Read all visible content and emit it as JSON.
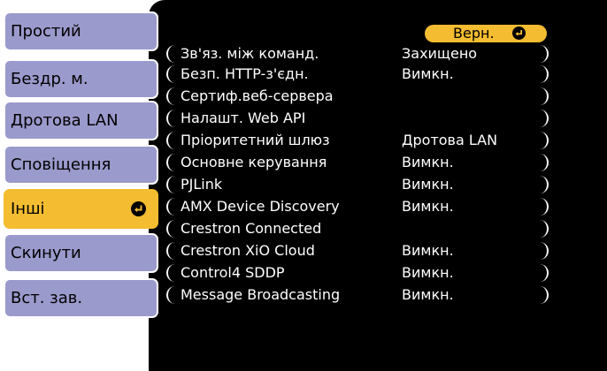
{
  "sidebar": {
    "items": [
      {
        "label": "Простий",
        "active": false
      },
      {
        "label": "Бездр. м.",
        "active": false
      },
      {
        "label": "Дротова LAN",
        "active": false
      },
      {
        "label": "Сповіщення",
        "active": false
      },
      {
        "label": "Інші",
        "active": true
      },
      {
        "label": "Скинути",
        "active": false
      },
      {
        "label": "Вст. зав.",
        "active": false
      }
    ]
  },
  "header": {
    "return_label": "Верн.",
    "return_icon": "enter-icon"
  },
  "settings": {
    "rows": [
      {
        "label": "Зв'яз. між команд.",
        "value": "Захищено"
      },
      {
        "label": "Безп. HTTP-з'єдн.",
        "value": "Вимкн."
      },
      {
        "label": "Сертиф.веб-сервера",
        "value": ""
      },
      {
        "label": "Налашт. Web API",
        "value": ""
      },
      {
        "label": "Пріоритетний шлюз",
        "value": "Дротова LAN"
      },
      {
        "label": "Основне керування",
        "value": "Вимкн."
      },
      {
        "label": "PJLink",
        "value": "Вимкн."
      },
      {
        "label": "AMX Device Discovery",
        "value": "Вимкн."
      },
      {
        "label": "Crestron Connected",
        "value": ""
      },
      {
        "label": "Crestron XiO Cloud",
        "value": "Вимкн."
      },
      {
        "label": "Control4 SDDP",
        "value": "Вимкн."
      },
      {
        "label": "Message Broadcasting",
        "value": "Вимкн."
      }
    ]
  },
  "colors": {
    "panel_background": "#000000",
    "sidebar_item": "#9A9ACC",
    "accent": "#F4BC30",
    "text_on_panel": "#FFFFFF"
  }
}
